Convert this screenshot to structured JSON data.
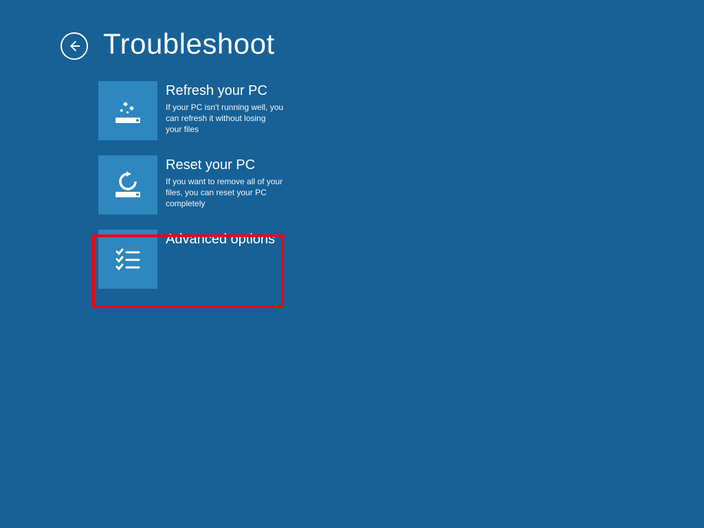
{
  "header": {
    "title": "Troubleshoot"
  },
  "options": {
    "refresh": {
      "title": "Refresh your PC",
      "desc": "If your PC isn't running well, you can refresh it without losing your files"
    },
    "reset": {
      "title": "Reset your PC",
      "desc": "If you want to remove all of your files, you can reset your PC completely"
    },
    "advanced": {
      "title": "Advanced options",
      "desc": ""
    }
  },
  "colors": {
    "background": "#176197",
    "tile": "#2e87be",
    "highlight": "#ff0000"
  }
}
